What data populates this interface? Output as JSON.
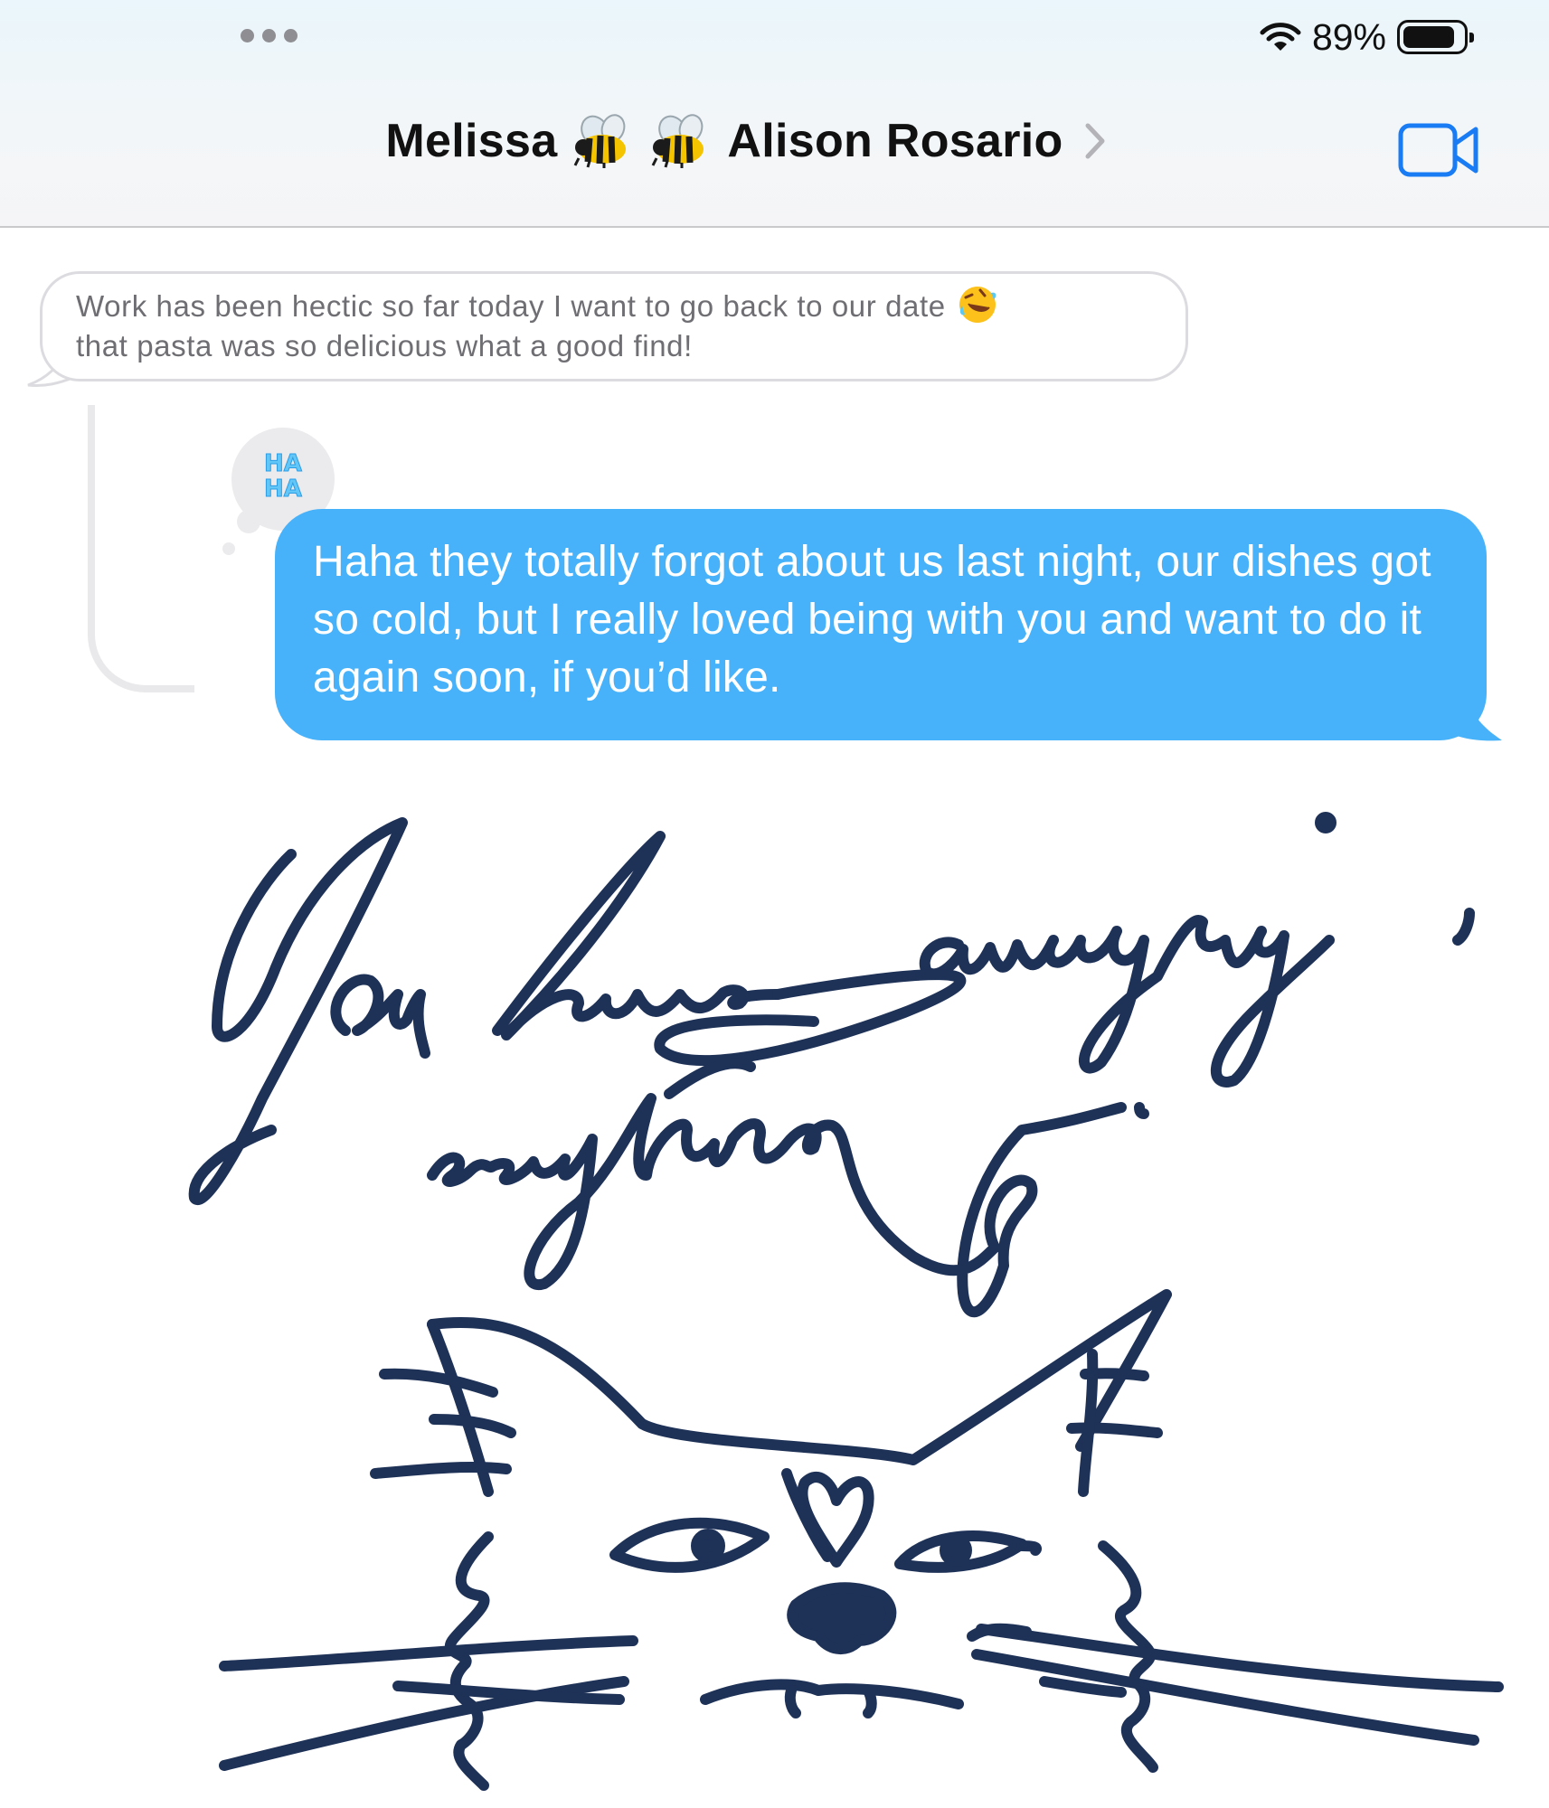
{
  "status_bar": {
    "battery_text": "89%",
    "battery_level": 0.89,
    "icons": [
      "more-dots-icon",
      "wifi-icon",
      "battery-icon"
    ]
  },
  "header": {
    "contact_first": "Melissa",
    "contact_emojis": [
      "bee-emoji",
      "bee-emoji"
    ],
    "contact_last": "Alison Rosario",
    "icons": [
      "chevron-right-icon",
      "facetime-video-icon"
    ]
  },
  "messages": [
    {
      "direction": "incoming",
      "text_line1": "Work has been hectic so far today I want to go back to our date",
      "emoji": "rofl-emoji",
      "text_line2": "that pasta was so delicious what a good find!"
    },
    {
      "direction": "outgoing",
      "tapback": "haha-icon",
      "tapback_text": "HA HA",
      "text": "Haha they totally forgot about us last night, our dishes got so cold, but I really loved being with you and want to do it again soon, if you’d like."
    },
    {
      "direction": "incoming",
      "type": "handwriting",
      "handwritten_text": "You have amazing, everything.",
      "drawing": "cat-face-with-heart-nose",
      "ink_color": "#1e3157"
    }
  ],
  "colors": {
    "outgoing_bubble": "#47b2fa",
    "accent_blue": "#1a7cf5",
    "incoming_border": "#dcdce0",
    "ink": "#1e3157"
  }
}
